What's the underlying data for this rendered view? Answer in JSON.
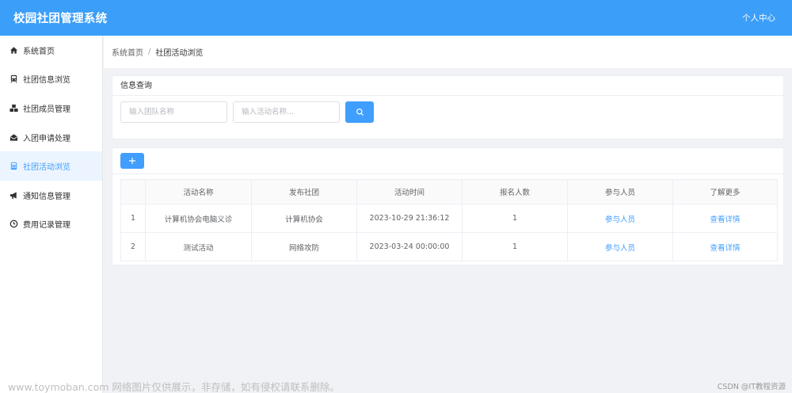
{
  "header": {
    "title": "校园社团管理系统",
    "user_center": "个人中心"
  },
  "sidebar": {
    "items": [
      {
        "label": "系统首页",
        "icon": "home-icon"
      },
      {
        "label": "社团信息浏览",
        "icon": "train-icon"
      },
      {
        "label": "社团成员管理",
        "icon": "cubes-icon"
      },
      {
        "label": "入团申请处理",
        "icon": "envelope-open-icon"
      },
      {
        "label": "社团活动浏览",
        "icon": "calculator-icon",
        "active": true
      },
      {
        "label": "通知信息管理",
        "icon": "bullhorn-icon"
      },
      {
        "label": "费用记录管理",
        "icon": "clock-icon"
      }
    ]
  },
  "breadcrumb": {
    "home": "系统首页",
    "separator": "/",
    "current": "社团活动浏览"
  },
  "search": {
    "title": "信息查询",
    "team_placeholder": "输入团队名称",
    "activity_placeholder": "输入活动名称...",
    "button_icon": "search-icon"
  },
  "toolbar": {
    "add_icon": "plus-icon"
  },
  "table": {
    "columns": [
      "",
      "活动名称",
      "发布社团",
      "活动时间",
      "报名人数",
      "参与人员",
      "了解更多"
    ],
    "rows": [
      {
        "index": "1",
        "name": "计算机协会电脑义诊",
        "club": "计算机协会",
        "time": "2023-10-29 21:36:12",
        "count": "1",
        "participants": "参与人员",
        "details": "查看详情"
      },
      {
        "index": "2",
        "name": "测试活动",
        "club": "网络攻防",
        "time": "2023-03-24 00:00:00",
        "count": "1",
        "participants": "参与人员",
        "details": "查看详情"
      }
    ]
  },
  "watermark": {
    "left": "www.toymoban.com 网络图片仅供展示，非存储，如有侵权请联系删除。",
    "right": "CSDN @IT教程资源"
  },
  "colors": {
    "header": "#3b9ef8",
    "primary": "#409eff",
    "active_bg": "#ecf5ff",
    "background": "#f0f2f5"
  }
}
